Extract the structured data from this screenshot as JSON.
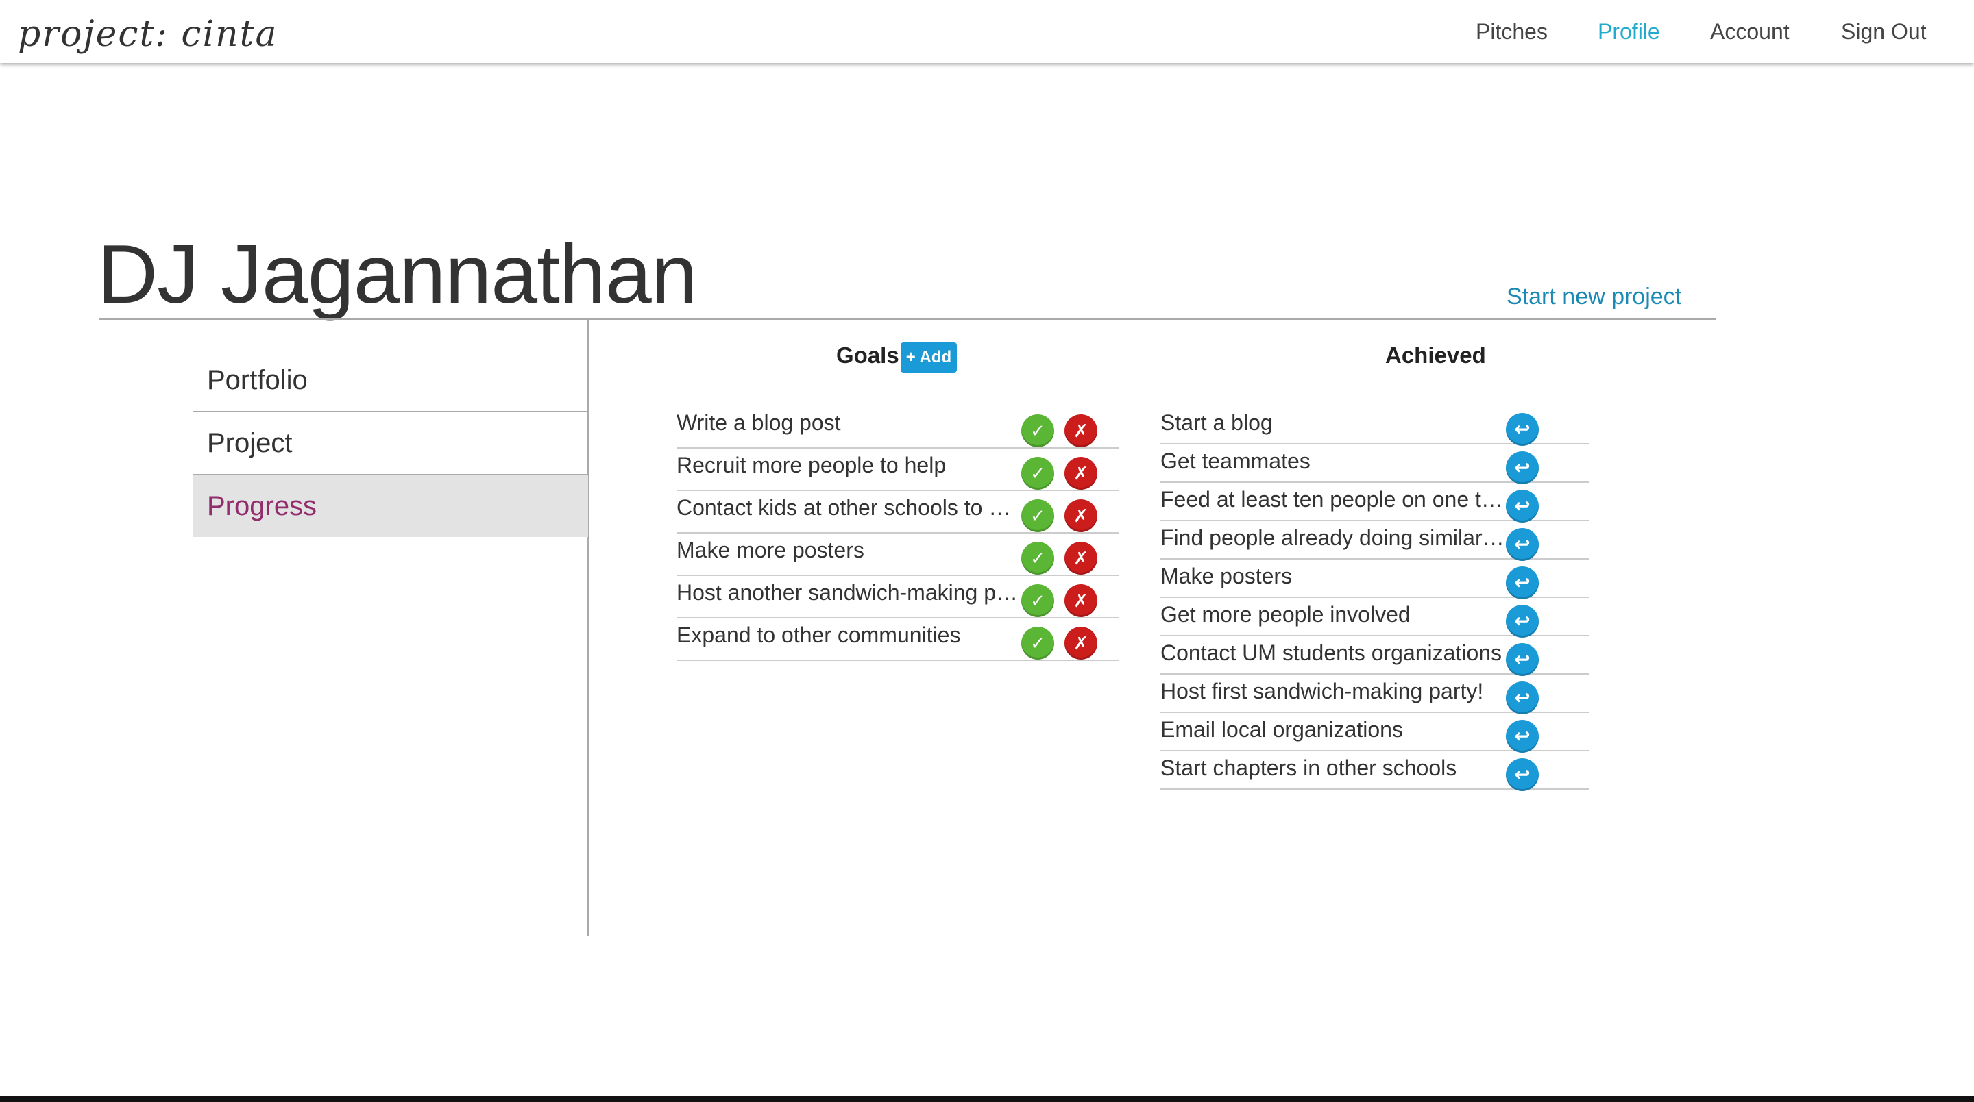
{
  "header": {
    "logo": "project: cinta",
    "nav": [
      "Pitches",
      "Profile",
      "Account",
      "Sign Out"
    ],
    "active_nav": "Profile"
  },
  "profile": {
    "name": "DJ Jagannathan",
    "start_link": "Start new project"
  },
  "sidebar": {
    "items": [
      "Portfolio",
      "Project",
      "Progress"
    ],
    "active": "Progress"
  },
  "goals": {
    "title": "Goals",
    "add_label": "+ Add",
    "items": [
      "Write a blog post",
      "Recruit more people to help",
      "Contact kids at other schools to get them involved",
      "Make more posters",
      "Host another sandwich-making party",
      "Expand to other communities"
    ],
    "complete_glyph": "✓",
    "remove_glyph": "✗"
  },
  "achieved": {
    "title": "Achieved",
    "items": [
      "Start a blog",
      "Get teammates",
      "Feed at least ten people on one trip",
      "Find people already doing similar things",
      "Make posters",
      "Get more people involved",
      "Contact UM students organizations",
      "Host first sandwich-making party!",
      "Email local organizations",
      "Start chapters in other schools"
    ],
    "undo_glyph": "↩"
  },
  "colors": {
    "accent": "#22aacc",
    "link": "#1a8ab5",
    "active_sidebar": "#922d6e",
    "ok": "#5bb636",
    "remove": "#cc1d1d",
    "undo": "#1a9ad6"
  }
}
